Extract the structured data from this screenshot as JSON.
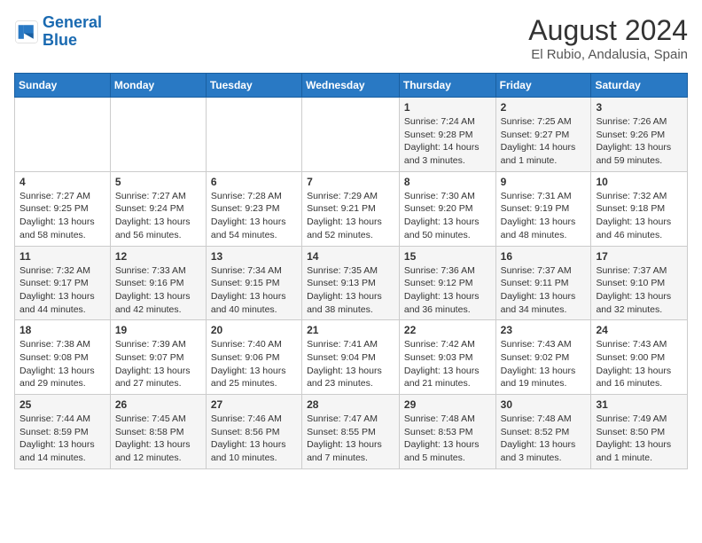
{
  "header": {
    "logo_line1": "General",
    "logo_line2": "Blue",
    "month_year": "August 2024",
    "location": "El Rubio, Andalusia, Spain"
  },
  "weekdays": [
    "Sunday",
    "Monday",
    "Tuesday",
    "Wednesday",
    "Thursday",
    "Friday",
    "Saturday"
  ],
  "weeks": [
    [
      {
        "day": "",
        "info": ""
      },
      {
        "day": "",
        "info": ""
      },
      {
        "day": "",
        "info": ""
      },
      {
        "day": "",
        "info": ""
      },
      {
        "day": "1",
        "info": "Sunrise: 7:24 AM\nSunset: 9:28 PM\nDaylight: 14 hours\nand 3 minutes."
      },
      {
        "day": "2",
        "info": "Sunrise: 7:25 AM\nSunset: 9:27 PM\nDaylight: 14 hours\nand 1 minute."
      },
      {
        "day": "3",
        "info": "Sunrise: 7:26 AM\nSunset: 9:26 PM\nDaylight: 13 hours\nand 59 minutes."
      }
    ],
    [
      {
        "day": "4",
        "info": "Sunrise: 7:27 AM\nSunset: 9:25 PM\nDaylight: 13 hours\nand 58 minutes."
      },
      {
        "day": "5",
        "info": "Sunrise: 7:27 AM\nSunset: 9:24 PM\nDaylight: 13 hours\nand 56 minutes."
      },
      {
        "day": "6",
        "info": "Sunrise: 7:28 AM\nSunset: 9:23 PM\nDaylight: 13 hours\nand 54 minutes."
      },
      {
        "day": "7",
        "info": "Sunrise: 7:29 AM\nSunset: 9:21 PM\nDaylight: 13 hours\nand 52 minutes."
      },
      {
        "day": "8",
        "info": "Sunrise: 7:30 AM\nSunset: 9:20 PM\nDaylight: 13 hours\nand 50 minutes."
      },
      {
        "day": "9",
        "info": "Sunrise: 7:31 AM\nSunset: 9:19 PM\nDaylight: 13 hours\nand 48 minutes."
      },
      {
        "day": "10",
        "info": "Sunrise: 7:32 AM\nSunset: 9:18 PM\nDaylight: 13 hours\nand 46 minutes."
      }
    ],
    [
      {
        "day": "11",
        "info": "Sunrise: 7:32 AM\nSunset: 9:17 PM\nDaylight: 13 hours\nand 44 minutes."
      },
      {
        "day": "12",
        "info": "Sunrise: 7:33 AM\nSunset: 9:16 PM\nDaylight: 13 hours\nand 42 minutes."
      },
      {
        "day": "13",
        "info": "Sunrise: 7:34 AM\nSunset: 9:15 PM\nDaylight: 13 hours\nand 40 minutes."
      },
      {
        "day": "14",
        "info": "Sunrise: 7:35 AM\nSunset: 9:13 PM\nDaylight: 13 hours\nand 38 minutes."
      },
      {
        "day": "15",
        "info": "Sunrise: 7:36 AM\nSunset: 9:12 PM\nDaylight: 13 hours\nand 36 minutes."
      },
      {
        "day": "16",
        "info": "Sunrise: 7:37 AM\nSunset: 9:11 PM\nDaylight: 13 hours\nand 34 minutes."
      },
      {
        "day": "17",
        "info": "Sunrise: 7:37 AM\nSunset: 9:10 PM\nDaylight: 13 hours\nand 32 minutes."
      }
    ],
    [
      {
        "day": "18",
        "info": "Sunrise: 7:38 AM\nSunset: 9:08 PM\nDaylight: 13 hours\nand 29 minutes."
      },
      {
        "day": "19",
        "info": "Sunrise: 7:39 AM\nSunset: 9:07 PM\nDaylight: 13 hours\nand 27 minutes."
      },
      {
        "day": "20",
        "info": "Sunrise: 7:40 AM\nSunset: 9:06 PM\nDaylight: 13 hours\nand 25 minutes."
      },
      {
        "day": "21",
        "info": "Sunrise: 7:41 AM\nSunset: 9:04 PM\nDaylight: 13 hours\nand 23 minutes."
      },
      {
        "day": "22",
        "info": "Sunrise: 7:42 AM\nSunset: 9:03 PM\nDaylight: 13 hours\nand 21 minutes."
      },
      {
        "day": "23",
        "info": "Sunrise: 7:43 AM\nSunset: 9:02 PM\nDaylight: 13 hours\nand 19 minutes."
      },
      {
        "day": "24",
        "info": "Sunrise: 7:43 AM\nSunset: 9:00 PM\nDaylight: 13 hours\nand 16 minutes."
      }
    ],
    [
      {
        "day": "25",
        "info": "Sunrise: 7:44 AM\nSunset: 8:59 PM\nDaylight: 13 hours\nand 14 minutes."
      },
      {
        "day": "26",
        "info": "Sunrise: 7:45 AM\nSunset: 8:58 PM\nDaylight: 13 hours\nand 12 minutes."
      },
      {
        "day": "27",
        "info": "Sunrise: 7:46 AM\nSunset: 8:56 PM\nDaylight: 13 hours\nand 10 minutes."
      },
      {
        "day": "28",
        "info": "Sunrise: 7:47 AM\nSunset: 8:55 PM\nDaylight: 13 hours\nand 7 minutes."
      },
      {
        "day": "29",
        "info": "Sunrise: 7:48 AM\nSunset: 8:53 PM\nDaylight: 13 hours\nand 5 minutes."
      },
      {
        "day": "30",
        "info": "Sunrise: 7:48 AM\nSunset: 8:52 PM\nDaylight: 13 hours\nand 3 minutes."
      },
      {
        "day": "31",
        "info": "Sunrise: 7:49 AM\nSunset: 8:50 PM\nDaylight: 13 hours\nand 1 minute."
      }
    ]
  ]
}
